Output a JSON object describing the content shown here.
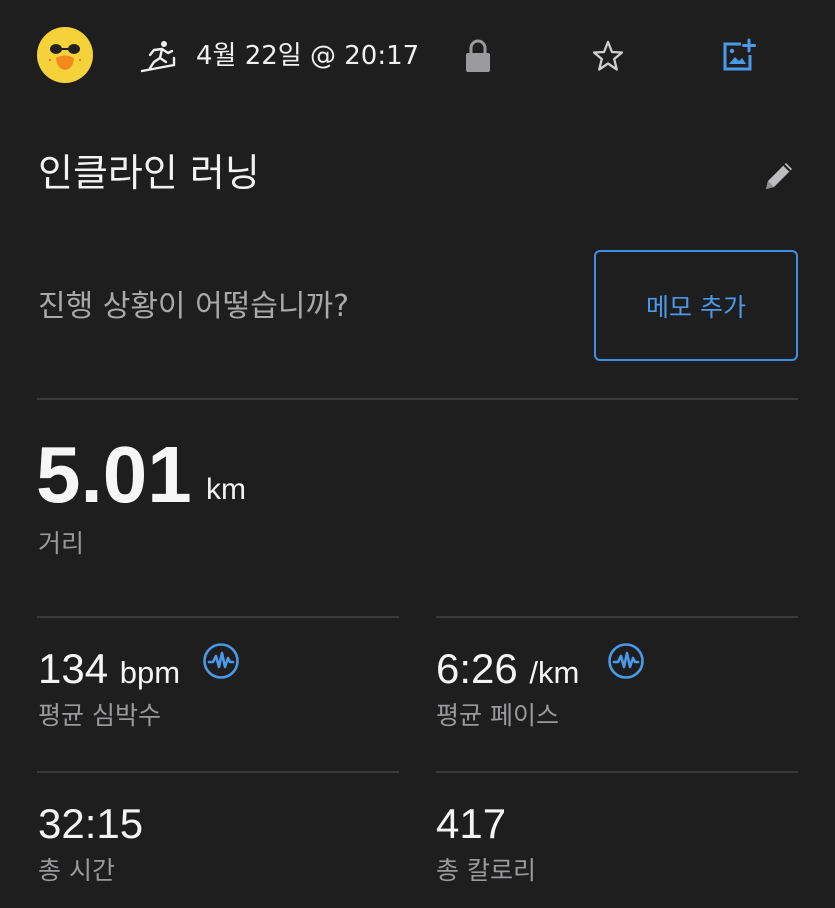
{
  "header": {
    "avatar_icon": "sally-chick-avatar",
    "activity_icon": "treadmill-runner-icon",
    "date_time": "4월 22일 @ 20:17",
    "lock_icon": "lock-icon",
    "favorite_icon": "star-icon",
    "add_photo_icon": "add-photo-icon"
  },
  "workout": {
    "title": "인클라인 러닝",
    "edit_icon": "pencil-icon"
  },
  "memo": {
    "prompt": "진행 상황이 어떻습니까?",
    "add_button": "메모 추가"
  },
  "distance": {
    "value": "5.01",
    "unit": "km",
    "label": "거리"
  },
  "stats": {
    "heart_rate": {
      "value": "134",
      "unit": "bpm",
      "label": "평균 심박수",
      "icon": "pulse-chart-icon"
    },
    "pace": {
      "value": "6:26",
      "unit": "/km",
      "label": "평균 페이스",
      "icon": "pulse-chart-icon"
    },
    "total_time": {
      "value": "32:15",
      "label": "총 시간"
    },
    "calories": {
      "value": "417",
      "label": "총 칼로리"
    }
  },
  "colors": {
    "background": "#1e1e1f",
    "accent": "#4a9ae8",
    "secondary_text": "#9a9a9c",
    "divider": "#3a3a3c"
  }
}
